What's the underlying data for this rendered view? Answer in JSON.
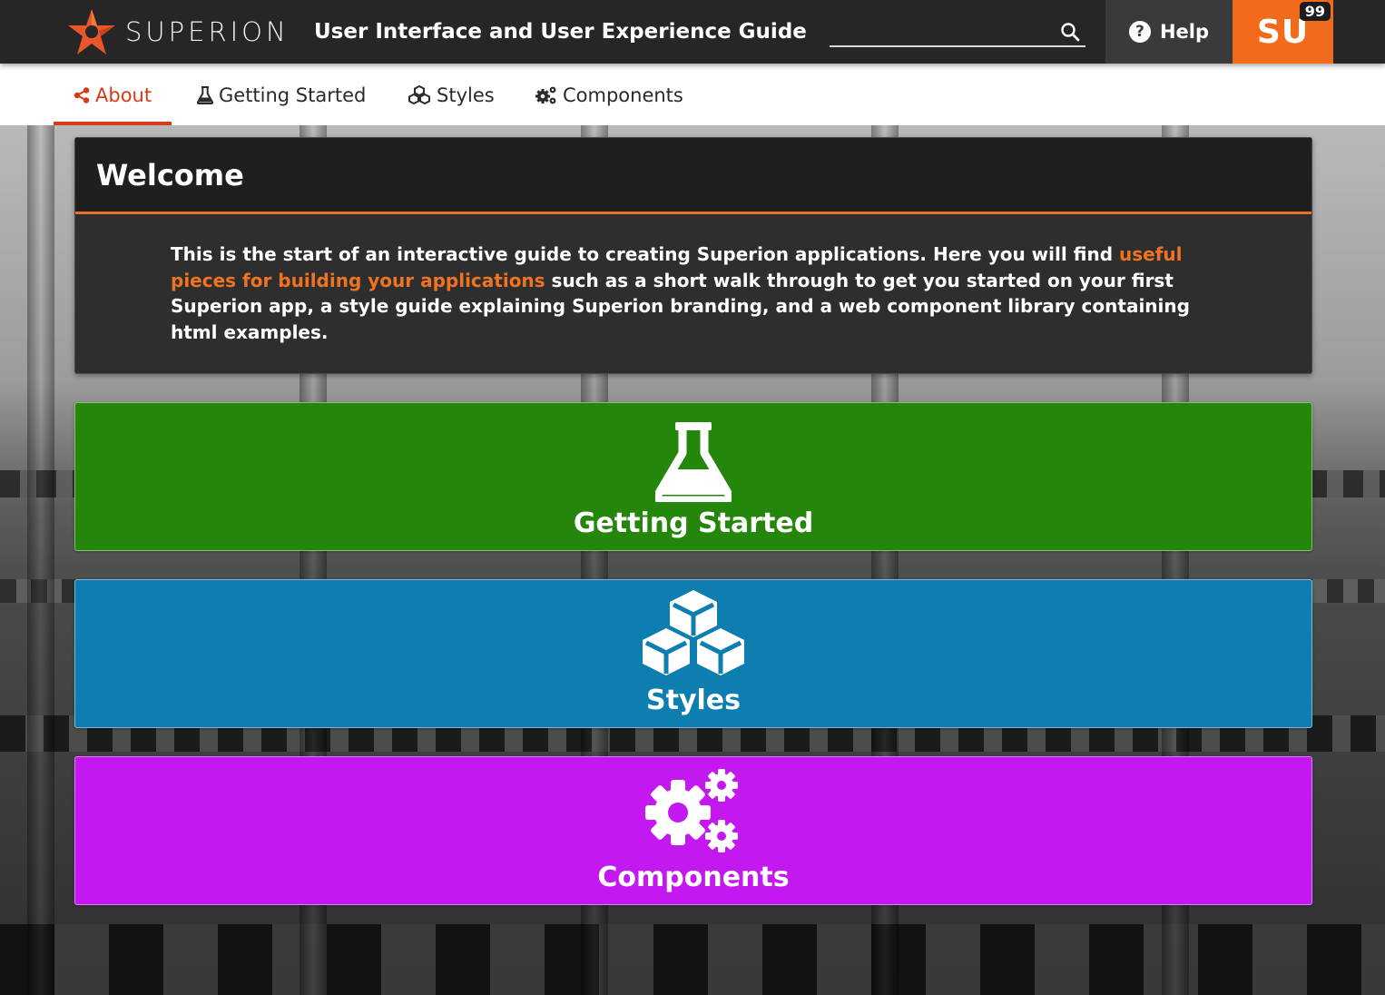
{
  "header": {
    "brand": "SUPERION",
    "app_title": "User Interface and User Experience Guide",
    "search": {
      "value": "",
      "placeholder": ""
    },
    "help_label": "Help",
    "user_initials": "SU",
    "notification_count": "99",
    "colors": {
      "bar": "#262626",
      "accent": "#f26a1b",
      "help_bg": "#3a3a3a"
    }
  },
  "nav": {
    "tabs": [
      {
        "label": "About",
        "icon": "share-icon",
        "active": true
      },
      {
        "label": "Getting Started",
        "icon": "flask-icon",
        "active": false
      },
      {
        "label": "Styles",
        "icon": "cubes-icon",
        "active": false
      },
      {
        "label": "Components",
        "icon": "cogs-icon",
        "active": false
      }
    ],
    "active_color": "#d93a16"
  },
  "welcome": {
    "title": "Welcome",
    "text_before": "This is the start of an interactive guide to creating Superion applications. Here you will find ",
    "highlight": "useful pieces for building your applications",
    "text_after": " such as a short walk through to get you started on your first Superion app, a style guide explaining Superion branding, and a web component library containing html examples.",
    "highlight_color": "#f07322"
  },
  "tiles": [
    {
      "label": "Getting Started",
      "icon": "flask-icon",
      "color": "#24870b"
    },
    {
      "label": "Styles",
      "icon": "cubes-icon",
      "color": "#0e7eb0"
    },
    {
      "label": "Components",
      "icon": "cogs-icon",
      "color": "#c318ef"
    }
  ]
}
